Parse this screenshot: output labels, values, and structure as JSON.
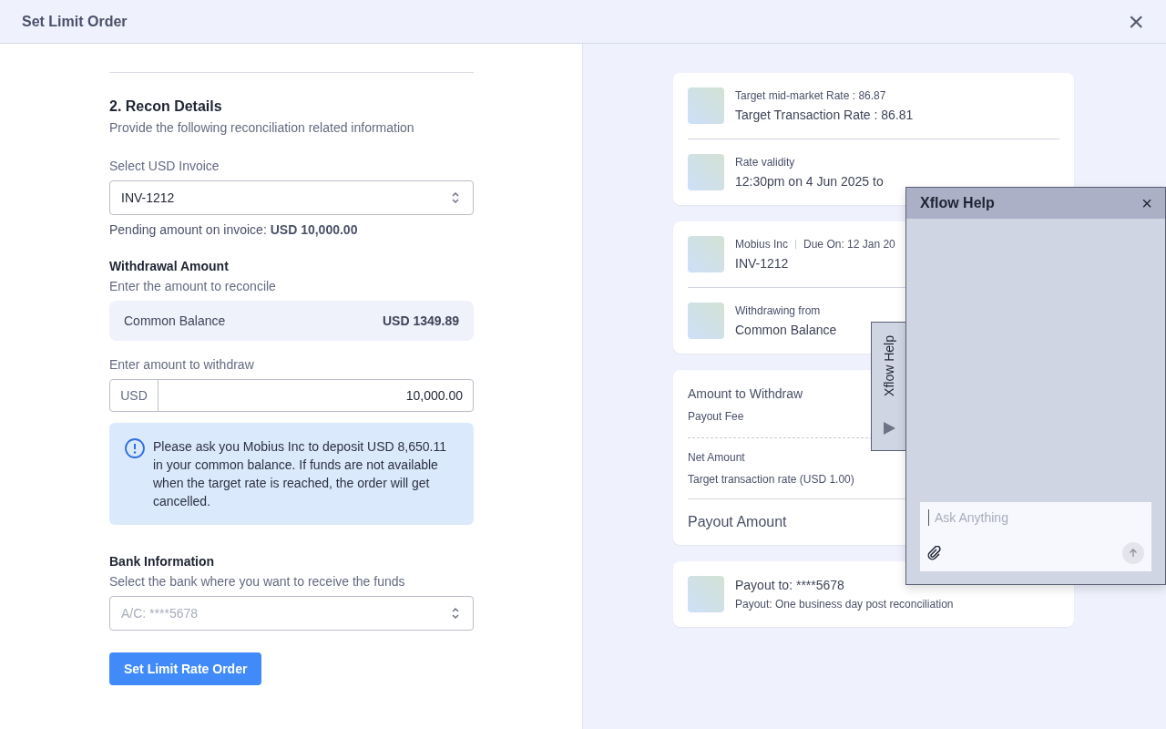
{
  "header": {
    "title": "Set Limit Order",
    "close": "×"
  },
  "section": {
    "title": "2. Recon Details",
    "subtitle": "Provide the following reconciliation related information"
  },
  "invoice": {
    "label": "Select USD Invoice",
    "value": "INV-1212",
    "pending": "Pending amount on invoice: **USD 10,000.00**"
  },
  "withdrawal": {
    "title": "Withdrawal Amount",
    "subtitle": "Enter the amount to reconcile",
    "balance_label": "Common Balance",
    "balance_value": "USD 1349.89",
    "amount_label": "Enter amount to withdraw",
    "currency": "USD",
    "amount": "10,000.00"
  },
  "notice": "Please ask you Mobius Inc to deposit USD 8,650.11 in your common balance. If funds are not available when the target rate is reached, the order will get cancelled.",
  "bank": {
    "title": "Bank Information",
    "subtitle": "Select the bank where you want to receive the funds",
    "placeholder": "A/C: ****5678"
  },
  "submit": "Set Limit Rate Order",
  "summary_cards": [
    {
      "kind": "rows",
      "rows": [
        {
          "small": "Target mid-market Rate : 86.87",
          "big": "Target Transaction Rate : 86.81"
        },
        {
          "small": "Rate validity",
          "big": "12:30pm on 4 Jun 2025 to"
        }
      ]
    },
    {
      "kind": "rows",
      "rows": [
        {
          "small": "Mobius Inc",
          "small_2": "Due On: 12 Jan 20",
          "big": "INV-1212"
        },
        {
          "small": "Withdrawing from",
          "big": "Common Balance"
        }
      ]
    },
    {
      "kind": "amounts",
      "lines": [
        "Amount to Withdraw",
        "Payout Fee"
      ],
      "lines_2": [
        "Net Amount",
        "Target transaction rate (USD  1.00)"
      ],
      "total": "Payout Amount"
    },
    {
      "kind": "payout",
      "rows": [
        {
          "big": "Payout to: ****5678",
          "small": "Payout: One business day post reconciliation"
        }
      ]
    }
  ],
  "help": {
    "tab": "Xflow Help",
    "title": "Xflow Help",
    "close": "×",
    "placeholder": "Ask Anything"
  }
}
